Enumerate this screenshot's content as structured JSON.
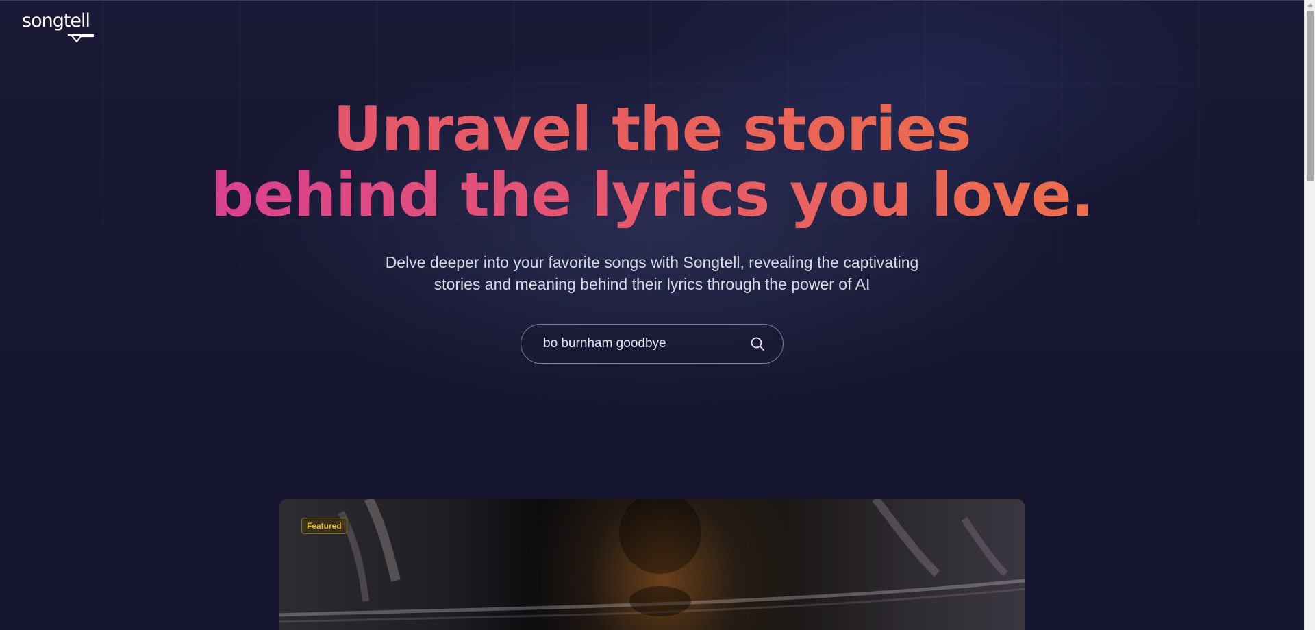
{
  "brand": {
    "logo_text": "songtell",
    "logo_icon": "speech-bubble-icon"
  },
  "hero": {
    "headline_line1": "Unravel the stories",
    "headline_line2": "behind the lyrics you love.",
    "subtitle_line1": "Delve deeper into your favorite songs with Songtell, revealing the captivating",
    "subtitle_line2": "stories and meaning behind their lyrics through the power of AI"
  },
  "search": {
    "value": "bo burnham goodbye",
    "icon": "search-icon"
  },
  "featured": {
    "badge": "Featured"
  },
  "colors": {
    "background": "#15152e",
    "headline_gradient_start": "#d9418f",
    "headline_gradient_end": "#ee6e4c",
    "badge_text": "#e9b52c"
  }
}
